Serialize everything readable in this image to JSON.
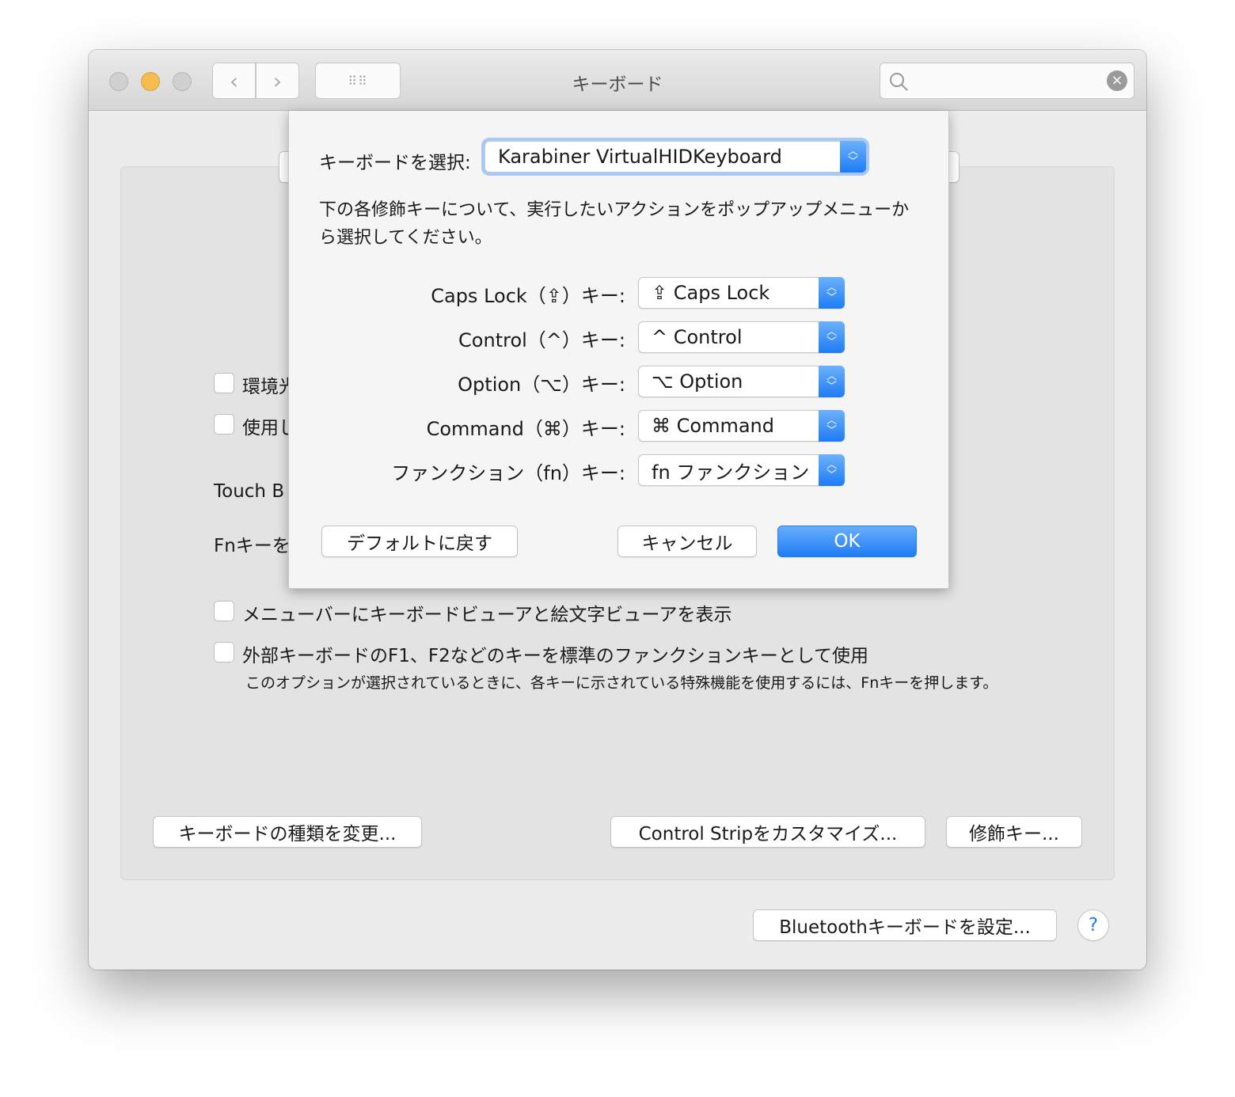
{
  "window": {
    "title": "キーボード",
    "back_icon": "chevron-left-icon",
    "forward_icon": "chevron-right-icon",
    "grid_icon": "grid-icon",
    "search_icon": "magnifier-icon",
    "clear_icon": "clear-icon"
  },
  "background": {
    "checkbox_ambient": "環境光",
    "checkbox_use": "使用し",
    "touch_bar_label": "Touch B",
    "fn_label": "Fnキーを",
    "checkbox_menu_bar": "メニューバーにキーボードビューアと絵文字ビューアを表示",
    "checkbox_fkeys": "外部キーボードのF1、F2などのキーを標準のファンクションキーとして使用",
    "fkeys_note": "このオプションが選択されているときに、各キーに示されている特殊機能を使用するには、Fnキーを押します。",
    "change_type_button": "キーボードの種類を変更...",
    "control_strip_button": "Control Stripをカスタマイズ...",
    "modifier_button": "修飾キー...",
    "bluetooth_button": "Bluetoothキーボードを設定...",
    "help_button": "?"
  },
  "sheet": {
    "select_label": "キーボードを選択:",
    "keyboard_value": "Karabiner VirtualHIDKeyboard",
    "instruction": "下の各修飾キーについて、実行したいアクションをポップアップメニューから選択してください。",
    "rows": [
      {
        "label": "Caps Lock（⇪）キー:",
        "value": "⇪ Caps Lock"
      },
      {
        "label": "Control（^）キー:",
        "value": "^ Control"
      },
      {
        "label": "Option（⌥）キー:",
        "value": "⌥ Option"
      },
      {
        "label": "Command（⌘）キー:",
        "value": "⌘ Command"
      },
      {
        "label": "ファンクション（fn）キー:",
        "value": "fn ファンクション"
      }
    ],
    "default_button": "デフォルトに戻す",
    "cancel_button": "キャンセル",
    "ok_button": "OK"
  },
  "colors": {
    "accent": "#1e7cf5",
    "minimize": "#f5bd4f"
  }
}
